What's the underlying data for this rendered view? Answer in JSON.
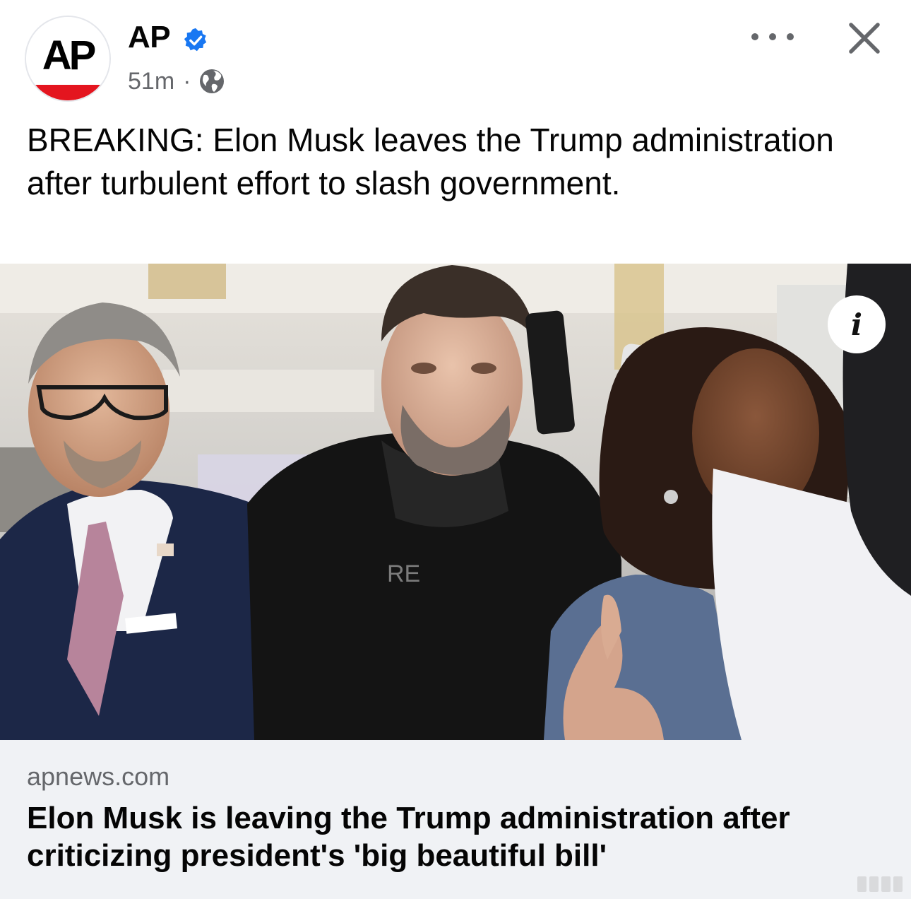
{
  "post": {
    "author": "AP",
    "avatar_text": "AP",
    "timestamp": "51m",
    "separator": "·",
    "text": "BREAKING: Elon Musk leaves the Trump administration after turbulent effort to slash government.",
    "icons": {
      "verified": "verified-badge-icon",
      "audience": "globe-icon",
      "more": "more-options-icon",
      "close": "close-icon"
    }
  },
  "media": {
    "info_glyph": "i",
    "shirt_text": "RE"
  },
  "link_preview": {
    "domain": "apnews.com",
    "title": "Elon Musk is leaving the Trump administration after criticizing president's 'big beautiful bill'"
  },
  "colors": {
    "brand_red": "#e4151f",
    "verified_blue": "#1877f2",
    "secondary_text": "#65676b",
    "link_card_bg": "#f0f2f5"
  }
}
